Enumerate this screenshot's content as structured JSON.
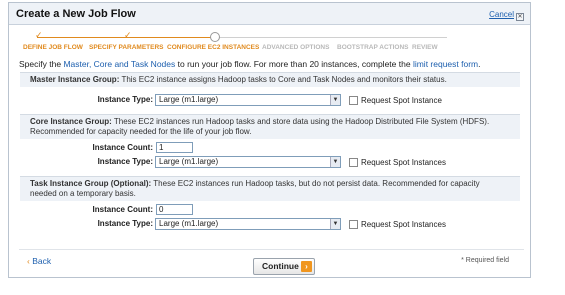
{
  "dialog": {
    "title": "Create a New Job Flow",
    "cancel_label": "Cancel",
    "cancel_icon": "close-icon"
  },
  "steps": [
    {
      "label": "DEFINE JOB FLOW",
      "state": "done"
    },
    {
      "label": "SPECIFY PARAMETERS",
      "state": "done"
    },
    {
      "label": "CONFIGURE EC2 INSTANCES",
      "state": "current"
    },
    {
      "label": "ADVANCED OPTIONS",
      "state": "todo"
    },
    {
      "label": "BOOTSTRAP ACTIONS",
      "state": "todo"
    },
    {
      "label": "REVIEW",
      "state": "todo"
    }
  ],
  "intro": {
    "prefix": "Specify the",
    "link1": "Master, Core and Task Nodes",
    "middle": "to run your job flow. For more than 20 instances, complete the",
    "link2": "limit request form",
    "suffix": "."
  },
  "master": {
    "heading": "Master Instance Group:",
    "description": "This EC2 instance assigns Hadoop tasks to Core and Task Nodes and monitors their status.",
    "instance_type_label": "Instance Type:",
    "instance_type_value": "Large (m1.large)",
    "spot_label": "Request Spot Instance"
  },
  "core": {
    "heading": "Core Instance Group:",
    "description_line1": "These EC2 instances run Hadoop tasks and store data using the Hadoop Distributed File System (HDFS).",
    "description_line2": "Recommended for capacity needed for the life of your job flow.",
    "instance_count_label": "Instance Count:",
    "instance_count_value": "1",
    "instance_type_label": "Instance Type:",
    "instance_type_value": "Large (m1.large)",
    "spot_label": "Request Spot Instances"
  },
  "task": {
    "heading": "Task Instance Group (Optional):",
    "description_line1": "These EC2 instances run Hadoop tasks, but do not persist data. Recommended for capacity",
    "description_line2": "needed on a temporary basis.",
    "instance_count_label": "Instance Count:",
    "instance_count_value": "0",
    "instance_type_label": "Instance Type:",
    "instance_type_value": "Large (m1.large)",
    "spot_label": "Request Spot Instances"
  },
  "footer": {
    "back_label": "Back",
    "back_icon": "chevron-left-icon",
    "continue_label": "Continue",
    "continue_icon": "chevron-right-icon",
    "required_note": "* Required field"
  }
}
